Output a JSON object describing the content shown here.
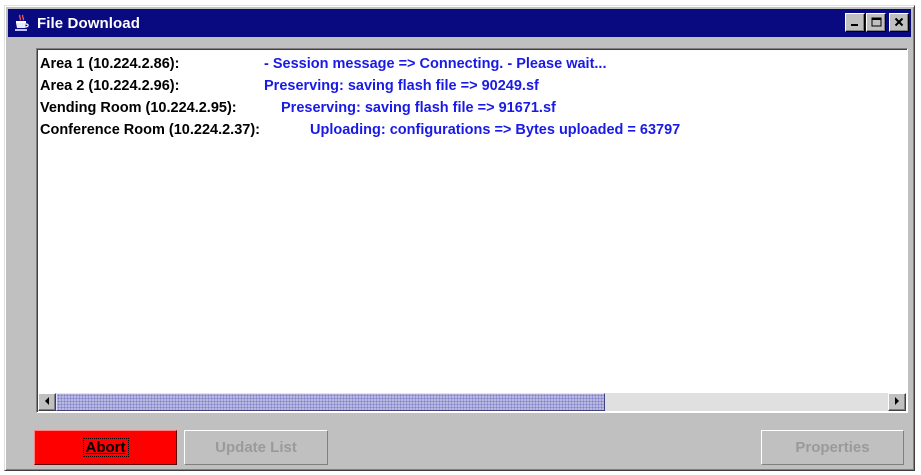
{
  "window": {
    "title": "File Download",
    "icon": "java-coffee-cup-icon",
    "controls": [
      "minimize-icon",
      "maximize-icon",
      "close-icon"
    ]
  },
  "log": [
    {
      "source": "Area 1 (10.224.2.86):",
      "message": "- Session message => Connecting.  - Please wait..."
    },
    {
      "source": "Area 2 (10.224.2.96):",
      "message": "Preserving: saving flash file => 90249.sf"
    },
    {
      "source": "Vending Room (10.224.2.95):",
      "message": "Preserving: saving flash file => 91671.sf"
    },
    {
      "source": "Conference Room (10.224.2.37):",
      "message": "Uploading: configurations  => Bytes uploaded = 63797"
    }
  ],
  "scrollbar": {
    "position_fraction": 0.0,
    "visible_fraction": 0.66
  },
  "buttons": {
    "abort": "Abort",
    "update_list": "Update List",
    "properties": "Properties"
  },
  "colors": {
    "titlebar": "#0a0a80",
    "message_text": "#1a1ae6",
    "abort_button": "#ff0000",
    "disabled_text": "#9a9a9a"
  }
}
